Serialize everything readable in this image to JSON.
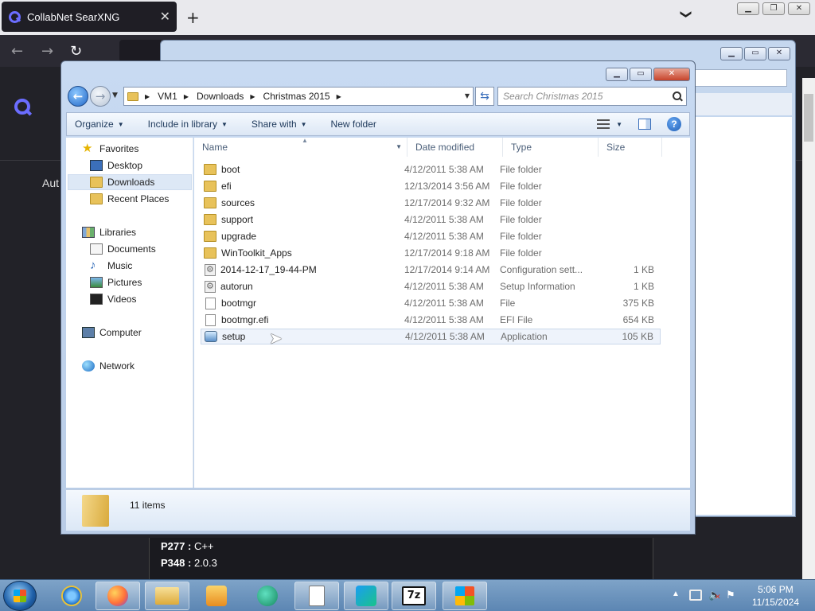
{
  "browser": {
    "tab_title": "CollabNet SearXNG",
    "tab_close": "✕",
    "new_tab": "+",
    "tab_list": "❯",
    "win_min": "▁",
    "win_restore": "❐",
    "win_close": "✕",
    "nav_back": "←",
    "nav_forward": "→",
    "nav_reload": "↻",
    "page_text_auto": "Aut",
    "results": [
      {
        "key": "P277 :",
        "value": "C++"
      },
      {
        "key": "P348 :",
        "value": "2.0.3"
      }
    ]
  },
  "explorer": {
    "caption_min": "▁",
    "caption_max": "▭",
    "caption_close": "✕",
    "back_arrow": "←",
    "forward_arrow": "→",
    "breadcrumb": [
      "VM1",
      "Downloads",
      "Christmas 2015"
    ],
    "crumb_sep": "▶",
    "search_placeholder": "Search Christmas 2015",
    "toolbar": {
      "organize": "Organize",
      "include_in_library": "Include in library",
      "share_with": "Share with",
      "new_folder": "New folder",
      "help": "?"
    },
    "nav": {
      "favorites": "Favorites",
      "desktop": "Desktop",
      "downloads": "Downloads",
      "recent_places": "Recent Places",
      "libraries": "Libraries",
      "documents": "Documents",
      "music": "Music",
      "pictures": "Pictures",
      "videos": "Videos",
      "computer": "Computer",
      "network": "Network"
    },
    "columns": {
      "name": "Name",
      "date_modified": "Date modified",
      "type": "Type",
      "size": "Size"
    },
    "files": [
      {
        "name": "boot",
        "date": "4/12/2011 5:38 AM",
        "type": "File folder",
        "size": "",
        "icon": "folder-icon"
      },
      {
        "name": "efi",
        "date": "12/13/2014 3:56 AM",
        "type": "File folder",
        "size": "",
        "icon": "folder-icon"
      },
      {
        "name": "sources",
        "date": "12/17/2014 9:32 AM",
        "type": "File folder",
        "size": "",
        "icon": "folder-icon"
      },
      {
        "name": "support",
        "date": "4/12/2011 5:38 AM",
        "type": "File folder",
        "size": "",
        "icon": "folder-icon"
      },
      {
        "name": "upgrade",
        "date": "4/12/2011 5:38 AM",
        "type": "File folder",
        "size": "",
        "icon": "folder-icon"
      },
      {
        "name": "WinToolkit_Apps",
        "date": "12/17/2014 9:18 AM",
        "type": "File folder",
        "size": "",
        "icon": "folder-icon"
      },
      {
        "name": "2014-12-17_19-44-PM",
        "date": "12/17/2014 9:14 AM",
        "type": "Configuration sett...",
        "size": "1 KB",
        "icon": "config-file-icon"
      },
      {
        "name": "autorun",
        "date": "4/12/2011 5:38 AM",
        "type": "Setup Information",
        "size": "1 KB",
        "icon": "config-file-icon"
      },
      {
        "name": "bootmgr",
        "date": "4/12/2011 5:38 AM",
        "type": "File",
        "size": "375 KB",
        "icon": "file-icon"
      },
      {
        "name": "bootmgr.efi",
        "date": "4/12/2011 5:38 AM",
        "type": "EFI File",
        "size": "654 KB",
        "icon": "file-icon"
      },
      {
        "name": "setup",
        "date": "4/12/2011 5:38 AM",
        "type": "Application",
        "size": "105 KB",
        "icon": "setup-app-icon"
      }
    ],
    "item_count": "11 items"
  },
  "taskbar": {
    "seven_zip": "7z",
    "time": "5:06 PM",
    "date": "11/15/2024",
    "tray_up": "▲"
  }
}
